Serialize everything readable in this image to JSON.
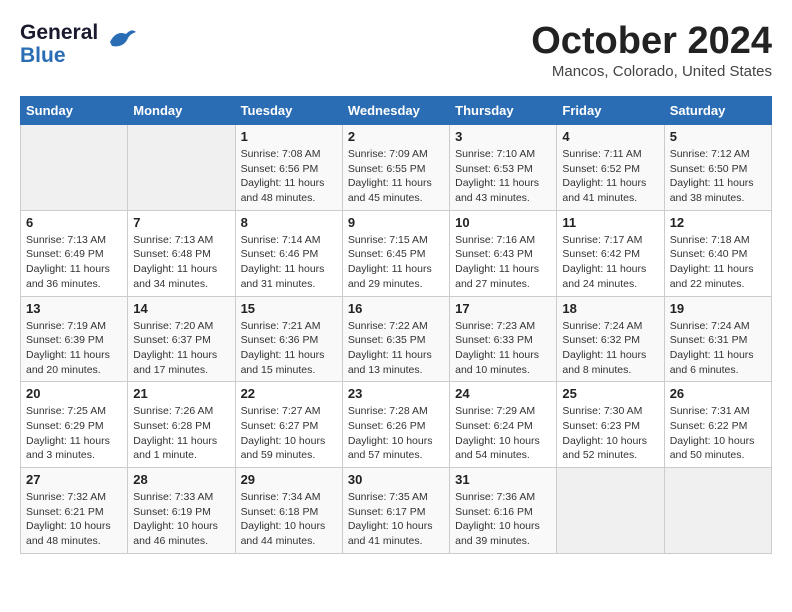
{
  "logo": {
    "line1": "General",
    "line2": "Blue",
    "icon": "▶"
  },
  "title": "October 2024",
  "location": "Mancos, Colorado, United States",
  "weekdays": [
    "Sunday",
    "Monday",
    "Tuesday",
    "Wednesday",
    "Thursday",
    "Friday",
    "Saturday"
  ],
  "weeks": [
    [
      {
        "day": "",
        "info": ""
      },
      {
        "day": "",
        "info": ""
      },
      {
        "day": "1",
        "info": "Sunrise: 7:08 AM\nSunset: 6:56 PM\nDaylight: 11 hours and 48 minutes."
      },
      {
        "day": "2",
        "info": "Sunrise: 7:09 AM\nSunset: 6:55 PM\nDaylight: 11 hours and 45 minutes."
      },
      {
        "day": "3",
        "info": "Sunrise: 7:10 AM\nSunset: 6:53 PM\nDaylight: 11 hours and 43 minutes."
      },
      {
        "day": "4",
        "info": "Sunrise: 7:11 AM\nSunset: 6:52 PM\nDaylight: 11 hours and 41 minutes."
      },
      {
        "day": "5",
        "info": "Sunrise: 7:12 AM\nSunset: 6:50 PM\nDaylight: 11 hours and 38 minutes."
      }
    ],
    [
      {
        "day": "6",
        "info": "Sunrise: 7:13 AM\nSunset: 6:49 PM\nDaylight: 11 hours and 36 minutes."
      },
      {
        "day": "7",
        "info": "Sunrise: 7:13 AM\nSunset: 6:48 PM\nDaylight: 11 hours and 34 minutes."
      },
      {
        "day": "8",
        "info": "Sunrise: 7:14 AM\nSunset: 6:46 PM\nDaylight: 11 hours and 31 minutes."
      },
      {
        "day": "9",
        "info": "Sunrise: 7:15 AM\nSunset: 6:45 PM\nDaylight: 11 hours and 29 minutes."
      },
      {
        "day": "10",
        "info": "Sunrise: 7:16 AM\nSunset: 6:43 PM\nDaylight: 11 hours and 27 minutes."
      },
      {
        "day": "11",
        "info": "Sunrise: 7:17 AM\nSunset: 6:42 PM\nDaylight: 11 hours and 24 minutes."
      },
      {
        "day": "12",
        "info": "Sunrise: 7:18 AM\nSunset: 6:40 PM\nDaylight: 11 hours and 22 minutes."
      }
    ],
    [
      {
        "day": "13",
        "info": "Sunrise: 7:19 AM\nSunset: 6:39 PM\nDaylight: 11 hours and 20 minutes."
      },
      {
        "day": "14",
        "info": "Sunrise: 7:20 AM\nSunset: 6:37 PM\nDaylight: 11 hours and 17 minutes."
      },
      {
        "day": "15",
        "info": "Sunrise: 7:21 AM\nSunset: 6:36 PM\nDaylight: 11 hours and 15 minutes."
      },
      {
        "day": "16",
        "info": "Sunrise: 7:22 AM\nSunset: 6:35 PM\nDaylight: 11 hours and 13 minutes."
      },
      {
        "day": "17",
        "info": "Sunrise: 7:23 AM\nSunset: 6:33 PM\nDaylight: 11 hours and 10 minutes."
      },
      {
        "day": "18",
        "info": "Sunrise: 7:24 AM\nSunset: 6:32 PM\nDaylight: 11 hours and 8 minutes."
      },
      {
        "day": "19",
        "info": "Sunrise: 7:24 AM\nSunset: 6:31 PM\nDaylight: 11 hours and 6 minutes."
      }
    ],
    [
      {
        "day": "20",
        "info": "Sunrise: 7:25 AM\nSunset: 6:29 PM\nDaylight: 11 hours and 3 minutes."
      },
      {
        "day": "21",
        "info": "Sunrise: 7:26 AM\nSunset: 6:28 PM\nDaylight: 11 hours and 1 minute."
      },
      {
        "day": "22",
        "info": "Sunrise: 7:27 AM\nSunset: 6:27 PM\nDaylight: 10 hours and 59 minutes."
      },
      {
        "day": "23",
        "info": "Sunrise: 7:28 AM\nSunset: 6:26 PM\nDaylight: 10 hours and 57 minutes."
      },
      {
        "day": "24",
        "info": "Sunrise: 7:29 AM\nSunset: 6:24 PM\nDaylight: 10 hours and 54 minutes."
      },
      {
        "day": "25",
        "info": "Sunrise: 7:30 AM\nSunset: 6:23 PM\nDaylight: 10 hours and 52 minutes."
      },
      {
        "day": "26",
        "info": "Sunrise: 7:31 AM\nSunset: 6:22 PM\nDaylight: 10 hours and 50 minutes."
      }
    ],
    [
      {
        "day": "27",
        "info": "Sunrise: 7:32 AM\nSunset: 6:21 PM\nDaylight: 10 hours and 48 minutes."
      },
      {
        "day": "28",
        "info": "Sunrise: 7:33 AM\nSunset: 6:19 PM\nDaylight: 10 hours and 46 minutes."
      },
      {
        "day": "29",
        "info": "Sunrise: 7:34 AM\nSunset: 6:18 PM\nDaylight: 10 hours and 44 minutes."
      },
      {
        "day": "30",
        "info": "Sunrise: 7:35 AM\nSunset: 6:17 PM\nDaylight: 10 hours and 41 minutes."
      },
      {
        "day": "31",
        "info": "Sunrise: 7:36 AM\nSunset: 6:16 PM\nDaylight: 10 hours and 39 minutes."
      },
      {
        "day": "",
        "info": ""
      },
      {
        "day": "",
        "info": ""
      }
    ]
  ]
}
